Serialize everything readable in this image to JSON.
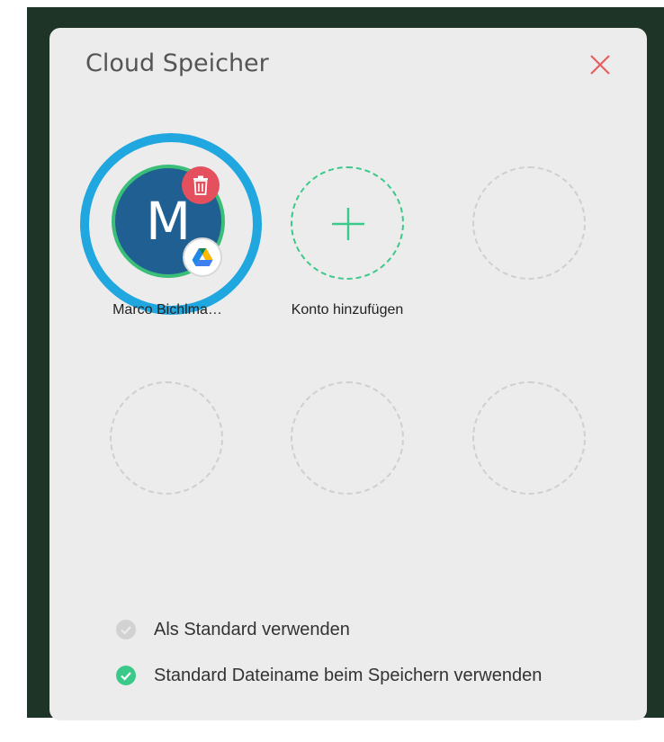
{
  "dialog": {
    "title": "Cloud Speicher"
  },
  "accounts": [
    {
      "initial": "M",
      "name": "Marco Bichlma…",
      "provider_icon": "google-drive-icon",
      "delete_icon": "trash-icon"
    }
  ],
  "add_account": {
    "label": "Konto hinzufügen"
  },
  "options": [
    {
      "label": "Als Standard verwenden",
      "checked": false
    },
    {
      "label": "Standard Dateiname beim Speichern verwenden",
      "checked": true
    }
  ],
  "colors": {
    "backdrop": "#1d3427",
    "dialog_background": "#ececec",
    "accent_green": "#3bc989",
    "avatar_blue": "#1f5f92",
    "delete_red": "#e4505d",
    "close_red": "#e46060",
    "highlight_ring": "#21a7df"
  }
}
